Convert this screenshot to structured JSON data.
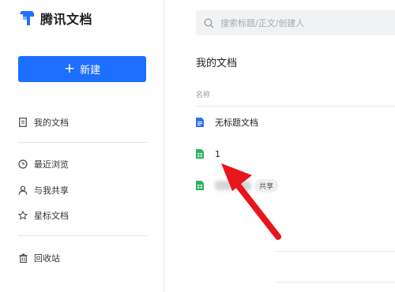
{
  "app": {
    "name": "腾讯文档",
    "brand_color": "#1e6fff"
  },
  "sidebar": {
    "new_button": {
      "label": "新建"
    },
    "items": [
      {
        "label": "我的文档",
        "icon": "document-icon"
      },
      {
        "label": "最近浏览",
        "icon": "clock-icon"
      },
      {
        "label": "与我共享",
        "icon": "person-icon"
      },
      {
        "label": "星标文档",
        "icon": "star-icon"
      },
      {
        "label": "回收站",
        "icon": "trash-icon"
      }
    ]
  },
  "search": {
    "placeholder": "搜索标题/正文/创建人",
    "value": ""
  },
  "main": {
    "title": "我的文档",
    "column_header": "名称",
    "docs": [
      {
        "name": "无标题文档",
        "type": "doc",
        "icon_color": "#2e6ff6"
      },
      {
        "name": "1",
        "type": "sheet",
        "icon_color": "#2bb460"
      },
      {
        "name": "",
        "type": "sheet",
        "icon_color": "#2bb460",
        "badge": "共享",
        "name_obscured": true
      }
    ]
  },
  "annotation": {
    "type": "arrow",
    "color": "#e8151b",
    "points_to": "1"
  }
}
